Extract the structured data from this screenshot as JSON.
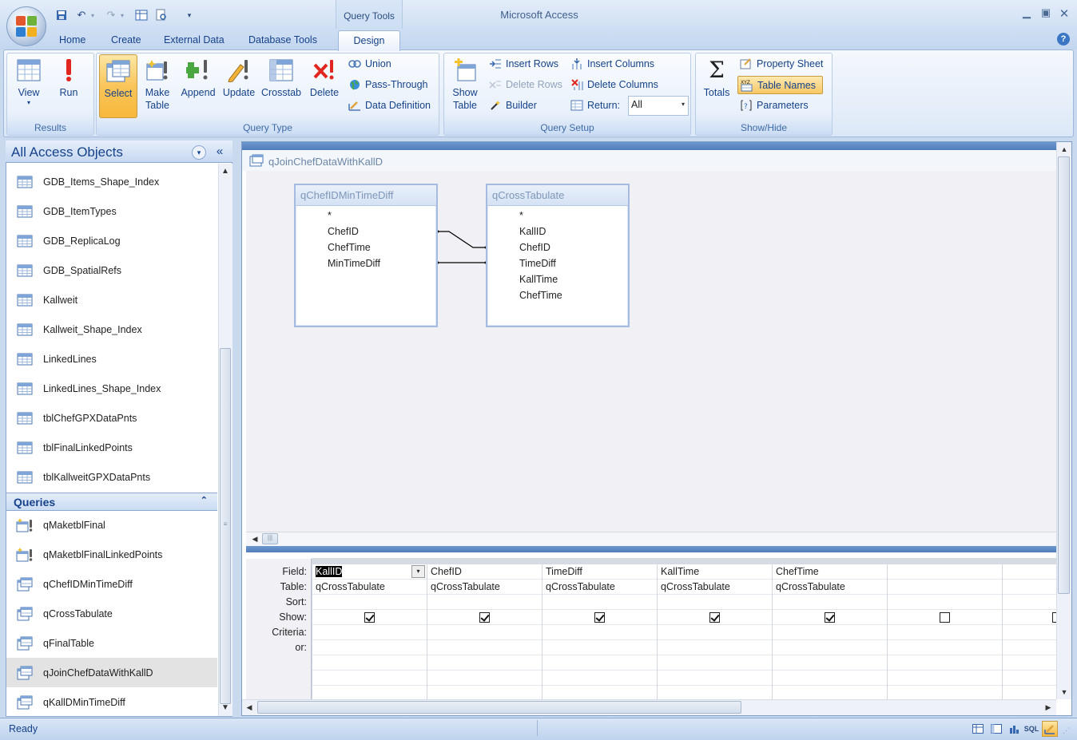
{
  "app": {
    "title": "Microsoft Access",
    "context_group": "Query Tools"
  },
  "tabs": [
    {
      "label": "Home"
    },
    {
      "label": "Create"
    },
    {
      "label": "External Data"
    },
    {
      "label": "Database Tools"
    },
    {
      "label": "Design",
      "active": true
    }
  ],
  "ribbon": {
    "results": {
      "label": "Results",
      "view": "View",
      "run": "Run"
    },
    "query_type": {
      "label": "Query Type",
      "select": "Select",
      "make_table_1": "Make",
      "make_table_2": "Table",
      "append": "Append",
      "update": "Update",
      "crosstab": "Crosstab",
      "delete": "Delete",
      "union": "Union",
      "pass_through": "Pass-Through",
      "data_definition": "Data Definition"
    },
    "query_setup": {
      "label": "Query Setup",
      "show_table_1": "Show",
      "show_table_2": "Table",
      "insert_rows": "Insert Rows",
      "delete_rows": "Delete Rows",
      "builder": "Builder",
      "insert_columns": "Insert Columns",
      "delete_columns": "Delete Columns",
      "return_label": "Return:",
      "return_value": "All"
    },
    "show_hide": {
      "label": "Show/Hide",
      "totals": "Totals",
      "property_sheet": "Property Sheet",
      "table_names": "Table Names",
      "parameters": "Parameters"
    }
  },
  "nav": {
    "header": "All Access Objects",
    "tables": [
      "GDB_Items_Shape_Index",
      "GDB_ItemTypes",
      "GDB_ReplicaLog",
      "GDB_SpatialRefs",
      "Kallweit",
      "Kallweit_Shape_Index",
      "LinkedLines",
      "LinkedLines_Shape_Index",
      "tblChefGPXDataPnts",
      "tblFinalLinkedPoints",
      "tblKallweitGPXDataPnts"
    ],
    "queries_header": "Queries",
    "queries": [
      "qMaketblFinal",
      "qMaketblFinalLinkedPoints",
      "qChefIDMinTimeDiff",
      "qCrossTabulate",
      "qFinalTable",
      "qJoinChefDataWithKallD",
      "qKallDMinTimeDiff"
    ]
  },
  "document": {
    "title": "qJoinChefDataWithKallD",
    "tables": [
      {
        "name": "qChefIDMinTimeDiff",
        "fields": [
          "*",
          "ChefID",
          "ChefTime",
          "MinTimeDiff"
        ]
      },
      {
        "name": "qCrossTabulate",
        "fields": [
          "*",
          "KallID",
          "ChefID",
          "TimeDiff",
          "KallTime",
          "ChefTime"
        ]
      }
    ],
    "grid": {
      "row_labels": [
        "Field:",
        "Table:",
        "Sort:",
        "Show:",
        "Criteria:",
        "or:"
      ],
      "columns": [
        {
          "field": "KallID",
          "table": "qCrossTabulate",
          "show": true
        },
        {
          "field": "ChefID",
          "table": "qCrossTabulate",
          "show": true
        },
        {
          "field": "TimeDiff",
          "table": "qCrossTabulate",
          "show": true
        },
        {
          "field": "KallTime",
          "table": "qCrossTabulate",
          "show": true
        },
        {
          "field": "ChefTime",
          "table": "qCrossTabulate",
          "show": true
        },
        {
          "field": "",
          "table": "",
          "show": false
        }
      ]
    }
  },
  "status": {
    "text": "Ready"
  }
}
